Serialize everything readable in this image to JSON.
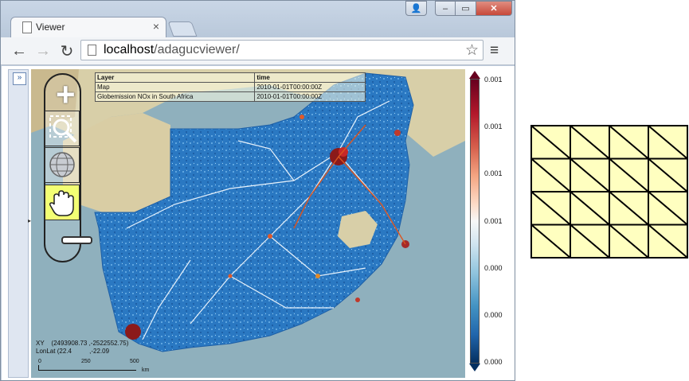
{
  "browser": {
    "tab_title": "Viewer",
    "tab_close": "×",
    "url_host": "localhost",
    "url_path": "/adagucviewer/",
    "window_controls": {
      "user": "👤",
      "minimize": "–",
      "maximize": "▭",
      "close": "✕"
    },
    "nav": {
      "back": "←",
      "forward": "→",
      "reload": "↻",
      "star": "☆",
      "menu": "≡"
    }
  },
  "viewer": {
    "expand_label": "»",
    "layer_table": {
      "headers": [
        "Layer",
        "time"
      ],
      "rows": [
        [
          "Map",
          "2010-01-01T00:00:00Z"
        ],
        [
          "Globemission NOx in South Africa",
          "2010-01-01T00:00:00Z"
        ]
      ]
    },
    "coords": {
      "xy_label": "XY",
      "xy_value": "(2493908.73 ,-2522552.75)",
      "lonlat_label": "LonLat",
      "lonlat_value": "(22.4          ,-22.09"
    },
    "scale": {
      "ticks": [
        "0",
        "250",
        "500"
      ],
      "unit": "km"
    },
    "legend": {
      "labels": [
        "0.001",
        "0.001",
        "0.001",
        "0.001",
        "0.000",
        "0.000",
        "0.000"
      ],
      "colors": {
        "high": "#67001f",
        "low": "#053061"
      }
    },
    "tools": [
      "zoom-in",
      "zoom-box",
      "globe",
      "pan",
      "zoom-out"
    ],
    "colors": {
      "accent_pan": "#f3ff74",
      "sea": "#8aa7b4",
      "land": "#d6c9a2",
      "data_blue": "#2a78c2"
    }
  },
  "grid_picture": {
    "rows": 4,
    "cols": 4,
    "fill": "#ffffc0",
    "stroke": "#000000"
  }
}
